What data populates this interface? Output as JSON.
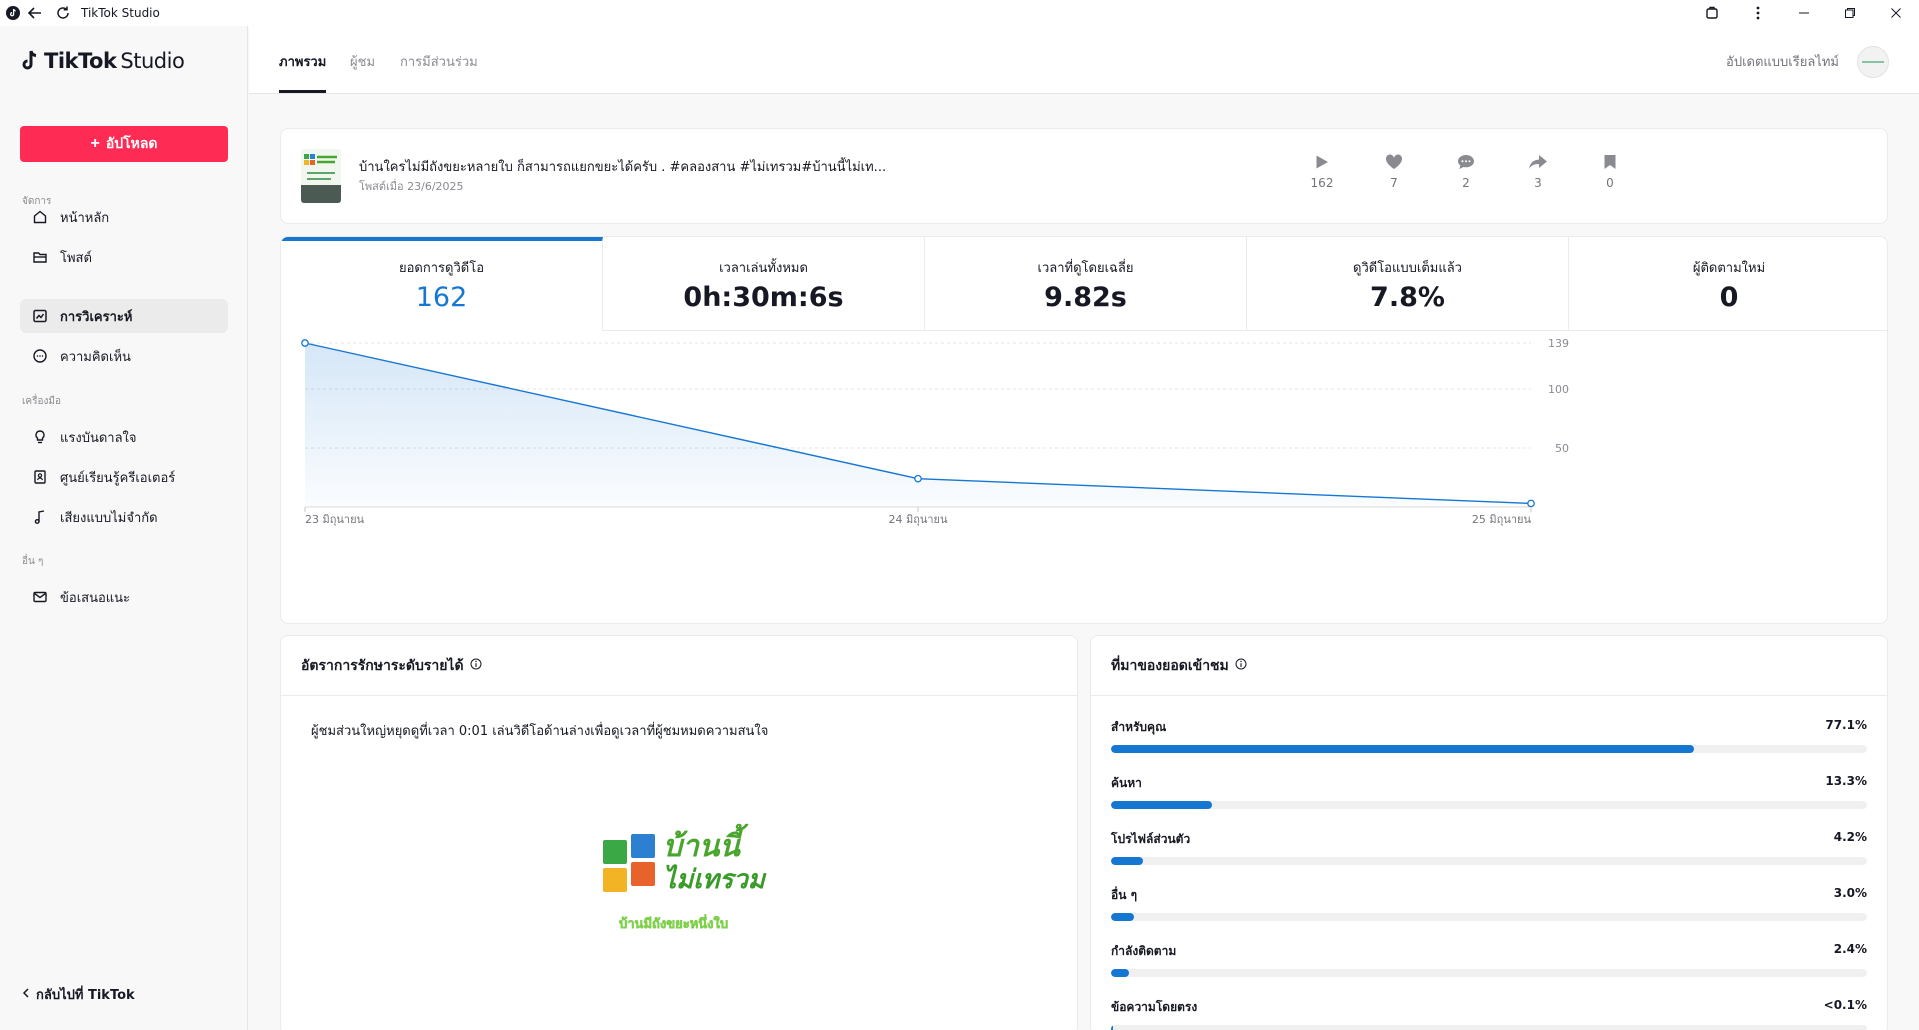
{
  "window": {
    "title": "TikTok Studio"
  },
  "brand": {
    "main": "TikTok",
    "sub": "Studio"
  },
  "sidebar": {
    "upload_label": "อัปโหลด",
    "sections": [
      {
        "label": "จัดการ",
        "items": [
          {
            "label": "หน้าหลัก",
            "icon": "home-icon"
          },
          {
            "label": "โพสต์",
            "icon": "folder-icon"
          },
          {
            "label": "การวิเคราะห์",
            "icon": "chart-icon",
            "active": true
          },
          {
            "label": "ความคิดเห็น",
            "icon": "comment-icon"
          }
        ]
      },
      {
        "label": "เครื่องมือ",
        "items": [
          {
            "label": "แรงบันดาลใจ",
            "icon": "bulb-icon"
          },
          {
            "label": "ศูนย์เรียนรู้ครีเอเตอร์",
            "icon": "book-icon"
          },
          {
            "label": "เสียงแบบไม่จำกัด",
            "icon": "music-icon"
          }
        ]
      },
      {
        "label": "อื่น ๆ",
        "items": [
          {
            "label": "ข้อเสนอแนะ",
            "icon": "mail-icon"
          }
        ]
      }
    ],
    "back_label": "กลับไปที่ TikTok"
  },
  "header": {
    "tabs": [
      "ภาพรวม",
      "ผู้ชม",
      "การมีส่วนร่วม"
    ],
    "active_tab": 0,
    "realtime_label": "อัปเดตแบบเรียลไทม์"
  },
  "video": {
    "title": "บ้านใครไม่มีถังขยะหลายใบ ก็สามารถแยกขยะได้ครับ . #คลองสาน #ไม่เทรวม#บ้านนี้ไม่เท...",
    "posted": "โพสต์เมื่อ 23/6/2025",
    "stats": [
      {
        "icon": "play-icon",
        "value": "162"
      },
      {
        "icon": "heart-icon",
        "value": "7"
      },
      {
        "icon": "comment-icon",
        "value": "2"
      },
      {
        "icon": "share-icon",
        "value": "3"
      },
      {
        "icon": "bookmark-icon",
        "value": "0"
      }
    ]
  },
  "metrics": [
    {
      "label": "ยอดการดูวิดีโอ",
      "value": "162",
      "active": true
    },
    {
      "label": "เวลาเล่นทั้งหมด",
      "value": "0h:30m:6s"
    },
    {
      "label": "เวลาที่ดูโดยเฉลี่ย",
      "value": "9.82s"
    },
    {
      "label": "ดูวิดีโอแบบเต็มแล้ว",
      "value": "7.8%"
    },
    {
      "label": "ผู้ติดตามใหม่",
      "value": "0"
    }
  ],
  "chart_data": {
    "type": "area",
    "x": [
      "23 มิถุนายน",
      "24 มิถุนายน",
      "25 มิถุนายน"
    ],
    "values": [
      139,
      24,
      3
    ],
    "yticks": [
      139,
      100,
      50
    ],
    "ylim": [
      0,
      139
    ],
    "grid": true,
    "color": "#1677d3"
  },
  "retention": {
    "title": "อัตราการรักษาระดับรายได้",
    "text": "ผู้ชมส่วนใหญ่หยุดดูที่เวลา 0:01 เล่นวิดีโอด้านล่างเพื่อดูเวลาที่ผู้ชมหมดความสนใจ",
    "logo_text": [
      "บ้านนี้",
      "ไม่เทรวม"
    ],
    "logo_caption": "บ้านมีถังขยะหนึ่งใบ"
  },
  "traffic": {
    "title": "ที่มาของยอดเข้าชม",
    "sources": [
      {
        "label": "สำหรับคุณ",
        "value": "77.1%",
        "fraction": 0.771
      },
      {
        "label": "ค้นหา",
        "value": "13.3%",
        "fraction": 0.133
      },
      {
        "label": "โปรไฟล์ส่วนตัว",
        "value": "4.2%",
        "fraction": 0.042
      },
      {
        "label": "อื่น ๆ",
        "value": "3.0%",
        "fraction": 0.03
      },
      {
        "label": "กำลังติดตาม",
        "value": "2.4%",
        "fraction": 0.024
      },
      {
        "label": "ข้อความโดยตรง",
        "value": "<0.1%",
        "fraction": 0.001
      }
    ]
  }
}
